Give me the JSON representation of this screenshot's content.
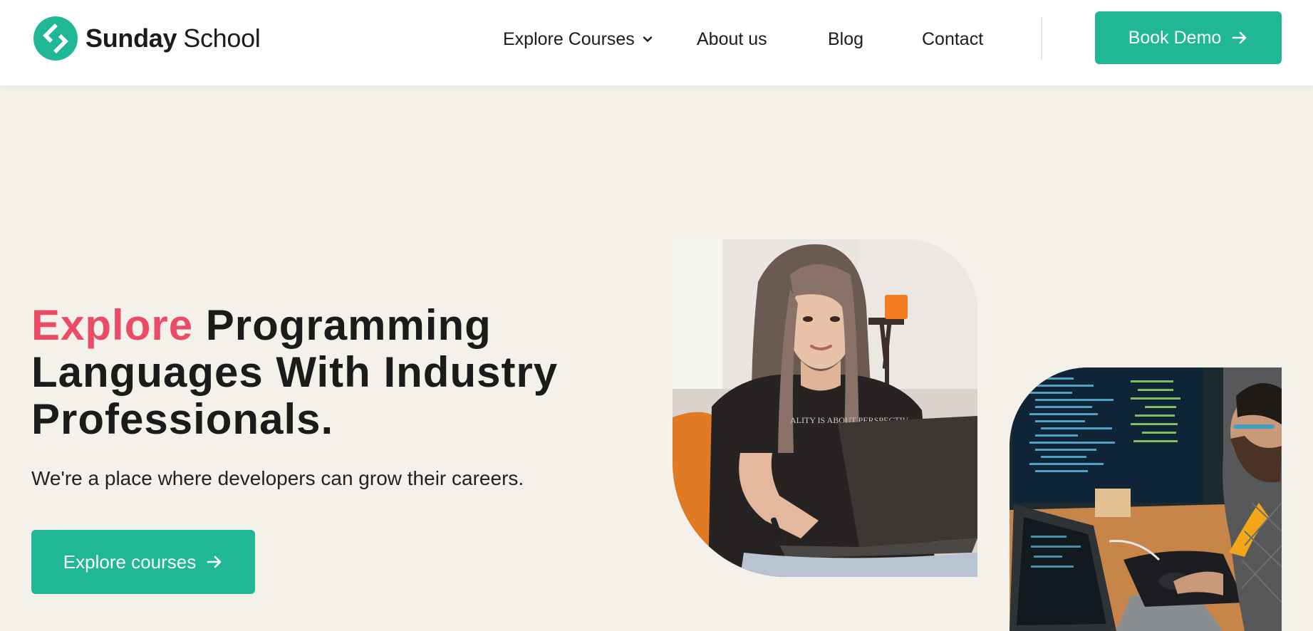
{
  "header": {
    "logo": {
      "bold": "Sunday",
      "light": "School"
    },
    "nav": [
      {
        "label": "Explore Courses",
        "has_dropdown": true
      },
      {
        "label": "About us"
      },
      {
        "label": "Blog"
      },
      {
        "label": "Contact"
      }
    ],
    "cta_label": "Book Demo"
  },
  "hero": {
    "title_accent": "Explore",
    "title_rest": "Programming Languages With Industry Professionals.",
    "subtitle": "We're a place where developers can grow their careers.",
    "cta_label": "Explore courses"
  },
  "colors": {
    "accent_teal": "#1fb795",
    "accent_pink": "#ea4c66",
    "page_background": "#f4f1eb",
    "header_background": "#ffffff"
  },
  "icons": {
    "logo": "sunday-school-logo-icon",
    "dropdown": "chevron-down-icon",
    "cta": "arrow-right-icon"
  },
  "images": [
    "woman-with-laptop-photo",
    "developer-coding-photo"
  ]
}
